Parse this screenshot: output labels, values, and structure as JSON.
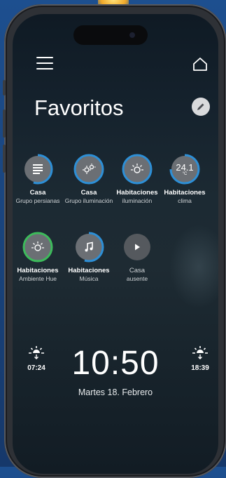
{
  "header": {
    "title": "Favoritos"
  },
  "favorites": [
    {
      "name": "Casa",
      "sub": "Grupo persianas",
      "icon": "blinds-icon",
      "ring": "#2d8fd6",
      "ring_fraction": 0.55
    },
    {
      "name": "Casa",
      "sub": "Grupo iluminación",
      "icon": "lights-icon",
      "ring": "#2d8fd6",
      "ring_fraction": 1.0
    },
    {
      "name": "Habitaciones",
      "sub": "iluminación",
      "icon": "bulb-icon",
      "ring": "#2d8fd6",
      "ring_fraction": 1.0
    },
    {
      "name": "Habitaciones",
      "sub": "clima",
      "icon": "thermostat-icon",
      "value": "24.1",
      "unit": "°C",
      "ring": "#2d8fd6",
      "ring_fraction": 0.75
    },
    {
      "name": "Habitaciones",
      "sub": "Ambiente Hue",
      "icon": "hue-bulb-icon",
      "ring": "#3dbb5b",
      "ring_fraction": 1.0
    },
    {
      "name": "Habitaciones",
      "sub": "Música",
      "icon": "music-note-icon",
      "ring": "#2d8fd6",
      "ring_fraction": 0.55
    },
    {
      "name": "Casa",
      "sub": "ausente",
      "icon": "play-icon",
      "ring": "",
      "ring_fraction": 0
    }
  ],
  "clock": {
    "time": "10:50",
    "date": "Martes 18. Febrero",
    "sunrise": "07:24",
    "sunset": "18:39"
  },
  "colors": {
    "accent": "#2d8fd6",
    "hue_green": "#3dbb5b",
    "tile": "#6b6f74"
  }
}
